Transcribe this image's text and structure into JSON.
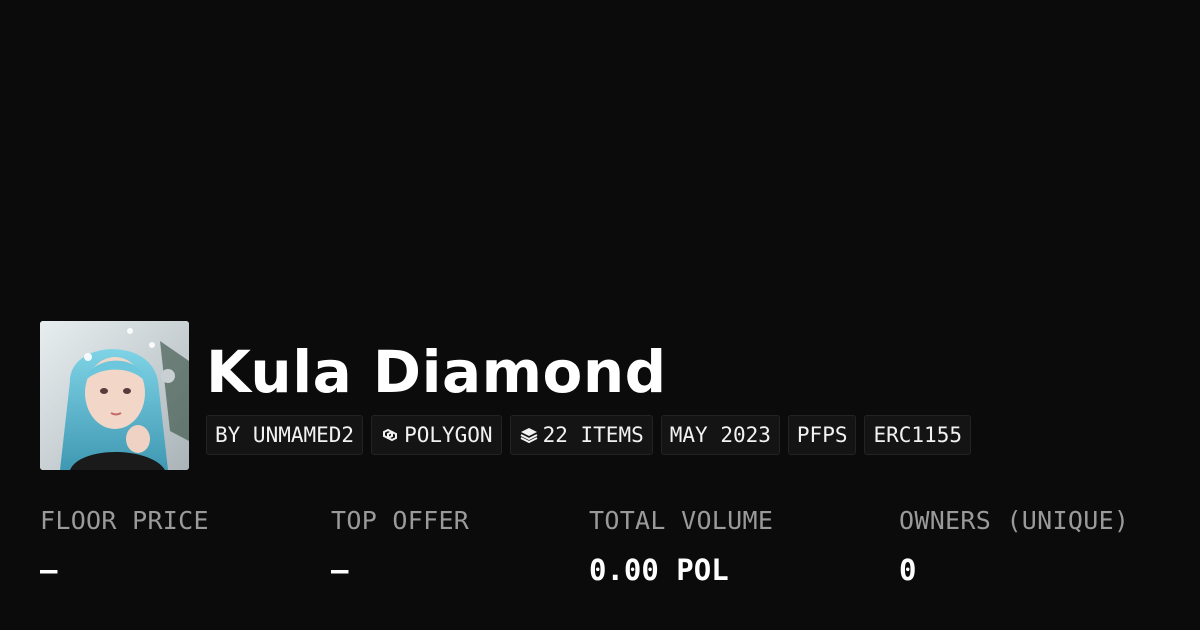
{
  "collection": {
    "title": "Kula Diamond",
    "avatar_alt": "collection-avatar"
  },
  "badges": [
    {
      "label": "BY UNMAMED2",
      "icon": null
    },
    {
      "label": "POLYGON",
      "icon": "polygon-chain-icon"
    },
    {
      "label": "22 ITEMS",
      "icon": "layers-icon"
    },
    {
      "label": "MAY 2023",
      "icon": null
    },
    {
      "label": "PFPS",
      "icon": null
    },
    {
      "label": "ERC1155",
      "icon": null
    }
  ],
  "stats": [
    {
      "label": "FLOOR PRICE",
      "value": "–"
    },
    {
      "label": "TOP OFFER",
      "value": "–"
    },
    {
      "label": "TOTAL VOLUME",
      "value": "0.00 POL"
    },
    {
      "label": "OWNERS (UNIQUE)",
      "value": "0"
    }
  ],
  "colors": {
    "background": "#0b0b0b",
    "badge_bg": "#141414",
    "label_gray": "#9a9a9a",
    "text": "#ffffff"
  }
}
